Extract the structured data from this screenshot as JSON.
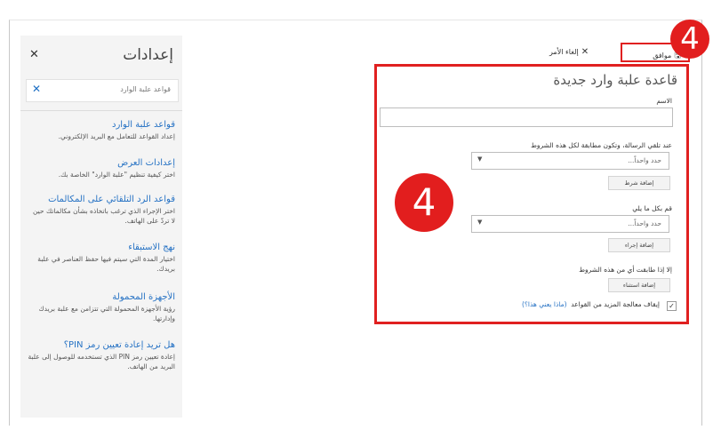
{
  "settings": {
    "title": "إعدادات",
    "search_value": "قواعد علبة الوارد",
    "items": [
      {
        "title": "قواعد علبة الوارد",
        "desc": "إعداد القواعد للتعامل مع البريد الإلكتروني."
      },
      {
        "title": "إعدادات العرض",
        "desc": "اختر كيفية تنظيم \"علبة الوارد\" الخاصة بك."
      },
      {
        "title": "قواعد الرد التلقائي على المكالمات",
        "desc": "اختر الإجراء الذي ترغب باتخاذه بشأن مكالماتك حين لا تردّ على الهاتف."
      },
      {
        "title": "نهج الاستبقاء",
        "desc": "اختيار المدة التي سيتم فيها حفظ العناصر في علبة بريدك."
      },
      {
        "title": "الأجهزة المحمولة",
        "desc": "رؤية الأجهزة المحمولة التي تتزامن مع علبة بريدك وإدارتها."
      },
      {
        "title": "هل تريد إعادة تعيين رمز PIN؟",
        "desc": "إعادة تعيين رمز PIN الذي تستخدمه للوصول إلى علبة البريد من الهاتف."
      }
    ]
  },
  "toolbar": {
    "ok_label": "موافق",
    "cancel_label": "إلغاء الأمر"
  },
  "badges": {
    "top": "4",
    "middle": "4"
  },
  "form": {
    "title": "قاعدة علبة وارد جديدة",
    "name_label": "الاسم",
    "name_value": "",
    "conditions_label": "عند تلقي الرسالة، وتكون مطابقة لكل هذه الشروط",
    "select_one_placeholder": "حدد واحداً...",
    "add_condition": "إضافة شرط",
    "actions_label": "قم بكل ما يلي",
    "select_two_placeholder": "حدد واحداً...",
    "add_action": "إضافة إجراء",
    "exceptions_label": "إلا إذا طابقت أي من هذه الشروط",
    "add_exception": "إضافة استثناء",
    "stop_label": "إيقاف معالجة المزيد من القواعد",
    "stop_link": "(ماذا يعني هذا؟)",
    "stop_checked": true
  }
}
